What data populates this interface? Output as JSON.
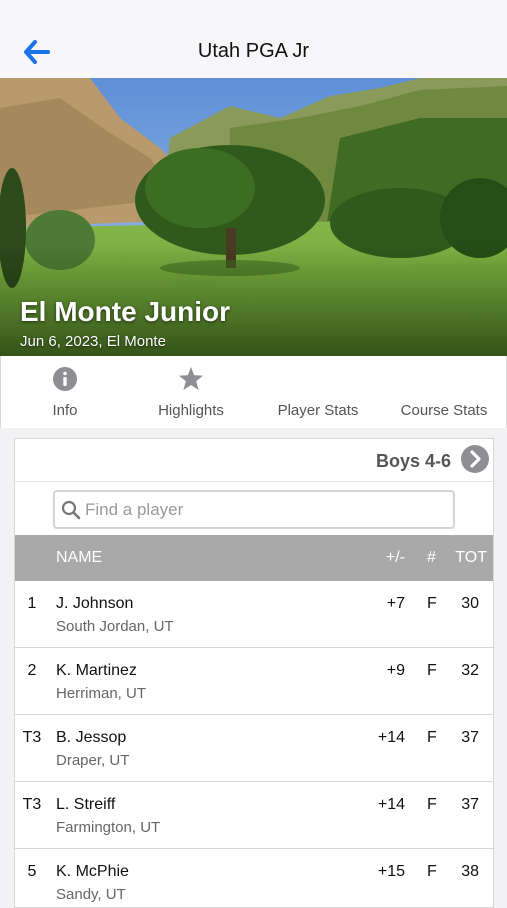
{
  "navbar": {
    "title": "Utah PGA Jr"
  },
  "hero": {
    "title": "El Monte Junior",
    "subtitle": "Jun 6, 2023, El Monte"
  },
  "tabs": [
    {
      "label": "Info",
      "icon": "info-icon"
    },
    {
      "label": "Highlights",
      "icon": "star-icon"
    },
    {
      "label": "Player Stats",
      "icon": ""
    },
    {
      "label": "Course Stats",
      "icon": ""
    }
  ],
  "leaderboard": {
    "division": "Boys 4-6",
    "search_placeholder": "Find a player",
    "columns": {
      "name": "NAME",
      "plus_minus": "+/-",
      "thru": "#",
      "total": "TOT"
    },
    "rows": [
      {
        "pos": "1",
        "name": "J. Johnson",
        "location": "South Jordan, UT",
        "plus_minus": "+7",
        "thru": "F",
        "total": "30"
      },
      {
        "pos": "2",
        "name": "K. Martinez",
        "location": "Herriman, UT",
        "plus_minus": "+9",
        "thru": "F",
        "total": "32"
      },
      {
        "pos": "T3",
        "name": "B. Jessop",
        "location": "Draper, UT",
        "plus_minus": "+14",
        "thru": "F",
        "total": "37"
      },
      {
        "pos": "T3",
        "name": "L. Streiff",
        "location": "Farmington, UT",
        "plus_minus": "+14",
        "thru": "F",
        "total": "37"
      },
      {
        "pos": "5",
        "name": "K. McPhie",
        "location": "Sandy, UT",
        "plus_minus": "+15",
        "thru": "F",
        "total": "38"
      }
    ]
  },
  "colors": {
    "accent": "#1a73e8",
    "header_bg": "#a9a9a9",
    "muted": "#8e8e93"
  }
}
